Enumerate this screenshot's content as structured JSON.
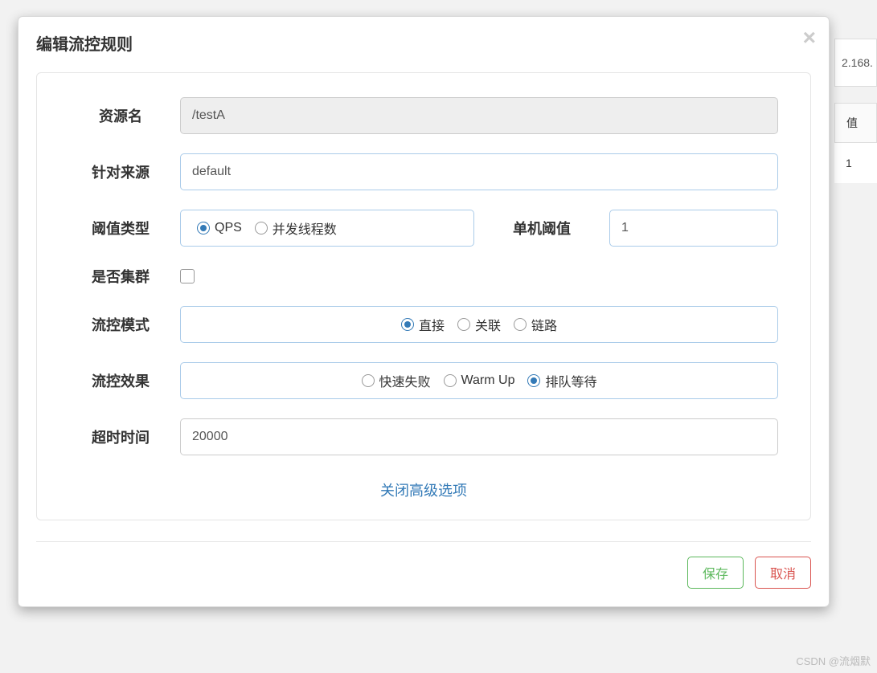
{
  "background": {
    "ip_fragment": "2.168.",
    "col_fragment": "值",
    "val_fragment": "1"
  },
  "modal": {
    "title": "编辑流控规则",
    "close_symbol": "×"
  },
  "form": {
    "resource": {
      "label": "资源名",
      "value": "/testA"
    },
    "source": {
      "label": "针对来源",
      "value": "default"
    },
    "threshold_type": {
      "label": "阈值类型",
      "options": [
        {
          "label": "QPS",
          "selected": true
        },
        {
          "label": "并发线程数",
          "selected": false
        }
      ]
    },
    "single_threshold": {
      "label": "单机阈值",
      "value": "1"
    },
    "cluster": {
      "label": "是否集群",
      "checked": false
    },
    "mode": {
      "label": "流控模式",
      "options": [
        {
          "label": "直接",
          "selected": true
        },
        {
          "label": "关联",
          "selected": false
        },
        {
          "label": "链路",
          "selected": false
        }
      ]
    },
    "effect": {
      "label": "流控效果",
      "options": [
        {
          "label": "快速失败",
          "selected": false
        },
        {
          "label": "Warm Up",
          "selected": false
        },
        {
          "label": "排队等待",
          "selected": true
        }
      ]
    },
    "timeout": {
      "label": "超时时间",
      "value": "20000"
    },
    "advanced_toggle": "关闭高级选项"
  },
  "footer": {
    "save": "保存",
    "cancel": "取消"
  },
  "watermark": "CSDN @流烟默"
}
